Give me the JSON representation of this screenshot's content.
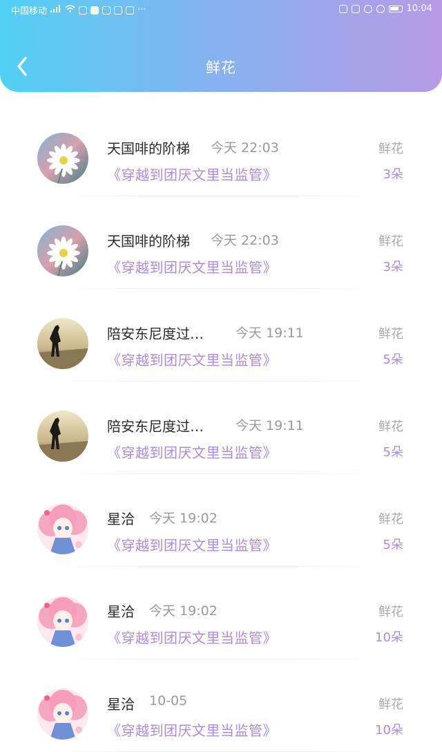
{
  "status_bar": {
    "carrier": "中国移动",
    "time": "10:04",
    "icons_left": [
      "signal-icon",
      "wifi-icon",
      "app-notification-icons",
      "more-icon"
    ],
    "icons_right": [
      "hd-icon",
      "nfc-icon",
      "alarm-icon",
      "mute-icon",
      "battery-icon"
    ]
  },
  "header": {
    "title": "鲜花",
    "back_icon": "chevron-left-icon",
    "gradient": [
      "#52d0f6",
      "#b79ae8"
    ]
  },
  "colors": {
    "book_title": "#b08ad8",
    "count": "#b08ad8",
    "label": "#a9a9a9",
    "time": "#999999"
  },
  "records": [
    {
      "name": "天国啡的阶梯",
      "time": "今天 22:03",
      "book": "《穿越到团厌文里当监管》",
      "label": "鲜花",
      "count": "3朵",
      "avatar": "daisy"
    },
    {
      "name": "天国啡的阶梯",
      "time": "今天 22:03",
      "book": "《穿越到团厌文里当监管》",
      "label": "鲜花",
      "count": "3朵",
      "avatar": "daisy"
    },
    {
      "name": "陪安东尼度过…",
      "time": "今天 19:11",
      "book": "《穿越到团厌文里当监管》",
      "label": "鲜花",
      "count": "5朵",
      "avatar": "silhouette"
    },
    {
      "name": "陪安东尼度过…",
      "time": "今天 19:11",
      "book": "《穿越到团厌文里当监管》",
      "label": "鲜花",
      "count": "5朵",
      "avatar": "silhouette"
    },
    {
      "name": "星洽",
      "time": "今天 19:02",
      "book": "《穿越到团厌文里当监管》",
      "label": "鲜花",
      "count": "5朵",
      "avatar": "anime-girl"
    },
    {
      "name": "星洽",
      "time": "今天 19:02",
      "book": "《穿越到团厌文里当监管》",
      "label": "鲜花",
      "count": "10朵",
      "avatar": "anime-girl"
    },
    {
      "name": "星洽",
      "time": "10-05",
      "book": "《穿越到团厌文里当监管》",
      "label": "鲜花",
      "count": "10朵",
      "avatar": "anime-girl"
    }
  ]
}
